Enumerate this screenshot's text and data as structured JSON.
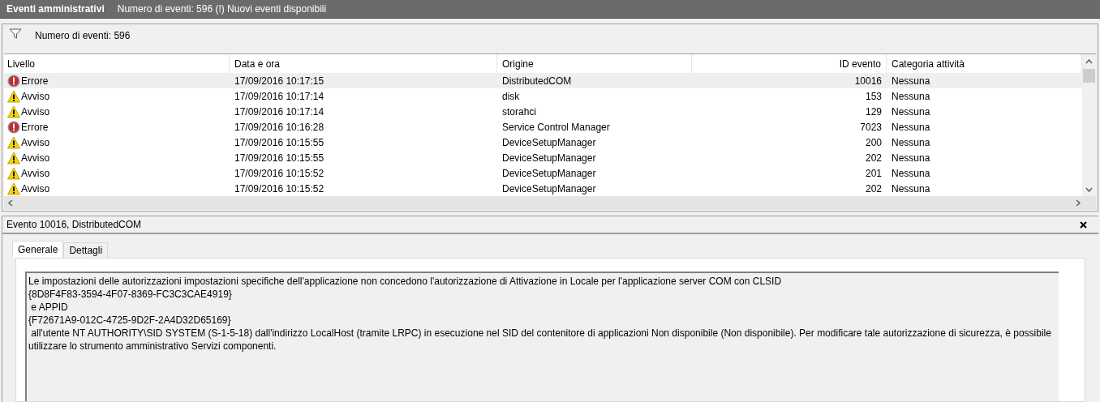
{
  "header": {
    "title": "Eventi amministrativi",
    "subtitle": "Numero di eventi: 596 (!) Nuovi eventi disponibili"
  },
  "filter_bar": {
    "label": "Numero di eventi: 596"
  },
  "table": {
    "columns": [
      "Livello",
      "Data e ora",
      "Origine",
      "ID evento",
      "Categoria attività"
    ],
    "rows": [
      {
        "kind": "error",
        "level": "Errore",
        "date": "17/09/2016 10:17:15",
        "source": "DistributedCOM",
        "id": "10016",
        "category": "Nessuna",
        "selected": true
      },
      {
        "kind": "warning",
        "level": "Avviso",
        "date": "17/09/2016 10:17:14",
        "source": "disk",
        "id": "153",
        "category": "Nessuna",
        "selected": false
      },
      {
        "kind": "warning",
        "level": "Avviso",
        "date": "17/09/2016 10:17:14",
        "source": "storahci",
        "id": "129",
        "category": "Nessuna",
        "selected": false
      },
      {
        "kind": "error",
        "level": "Errore",
        "date": "17/09/2016 10:16:28",
        "source": "Service Control Manager",
        "id": "7023",
        "category": "Nessuna",
        "selected": false
      },
      {
        "kind": "warning",
        "level": "Avviso",
        "date": "17/09/2016 10:15:55",
        "source": "DeviceSetupManager",
        "id": "200",
        "category": "Nessuna",
        "selected": false
      },
      {
        "kind": "warning",
        "level": "Avviso",
        "date": "17/09/2016 10:15:55",
        "source": "DeviceSetupManager",
        "id": "202",
        "category": "Nessuna",
        "selected": false
      },
      {
        "kind": "warning",
        "level": "Avviso",
        "date": "17/09/2016 10:15:52",
        "source": "DeviceSetupManager",
        "id": "201",
        "category": "Nessuna",
        "selected": false
      },
      {
        "kind": "warning",
        "level": "Avviso",
        "date": "17/09/2016 10:15:52",
        "source": "DeviceSetupManager",
        "id": "202",
        "category": "Nessuna",
        "selected": false
      }
    ]
  },
  "detail": {
    "title": "Evento 10016, DistributedCOM",
    "tabs": [
      {
        "label": "Generale",
        "selected": true
      },
      {
        "label": "Dettagli",
        "selected": false
      }
    ],
    "description": [
      "Le impostazioni delle autorizzazioni impostazioni specifiche dell'applicazione non concedono l'autorizzazione di Attivazione in Locale per l'applicazione server COM con CLSID",
      "{8D8F4F83-3594-4F07-8369-FC3C3CAE4919}",
      " e APPID",
      "{F72671A9-012C-4725-9D2F-2A4D32D65169}",
      " all'utente NT AUTHORITY\\SID SYSTEM (S-1-5-18) dall'indirizzo LocalHost (tramite LRPC) in esecuzione nel SID del contenitore di applicazioni Non disponibile (Non disponibile). Per modificare tale autorizzazione di sicurezza, è possibile utilizzare lo strumento amministrativo Servizi componenti."
    ]
  }
}
